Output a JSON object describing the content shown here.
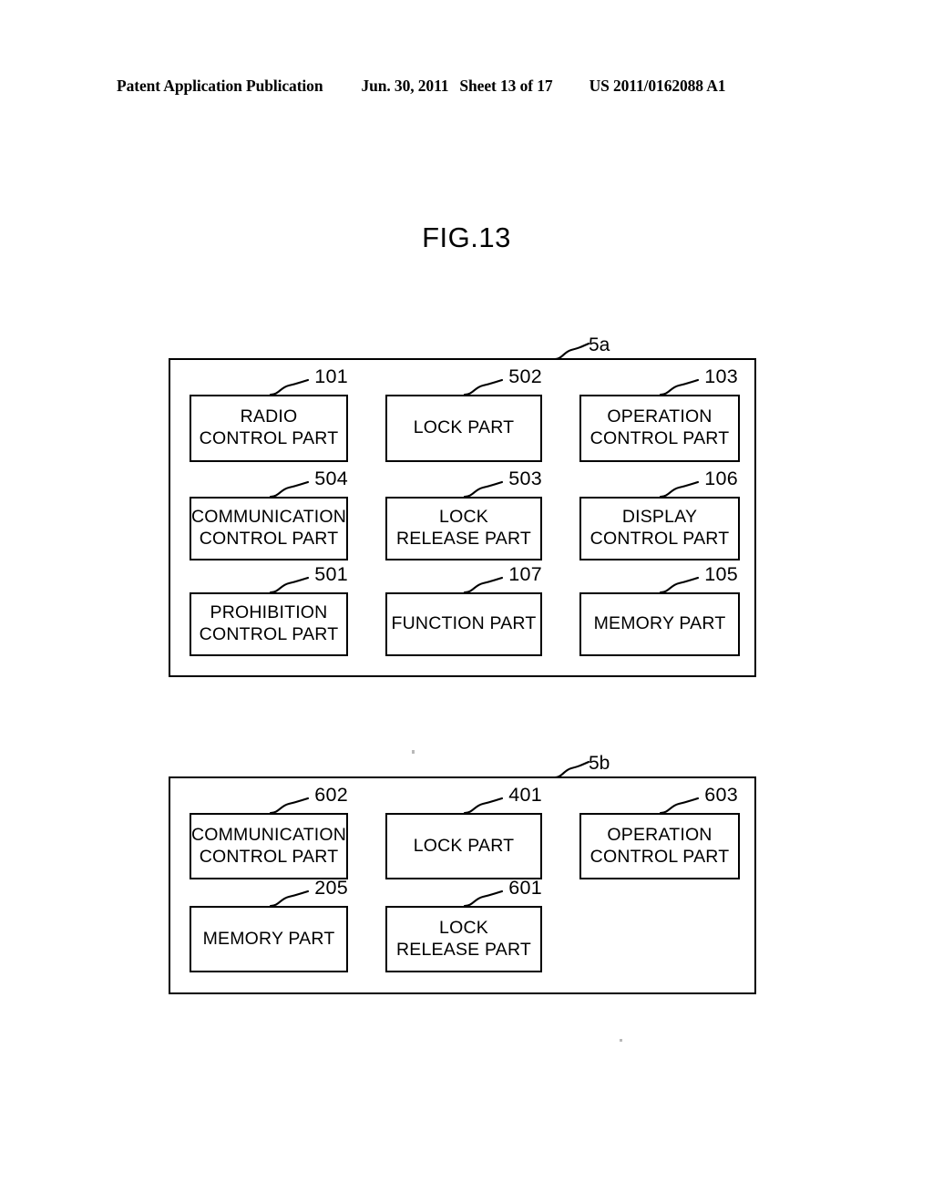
{
  "header": {
    "publication": "Patent Application Publication",
    "date": "Jun. 30, 2011",
    "sheet": "Sheet 13 of 17",
    "document_number": "US 2011/0162088 A1"
  },
  "figure": {
    "title": "FIG.13"
  },
  "diagrams": [
    {
      "id": "5a",
      "tag": "5a",
      "boxes": [
        {
          "ref": "101",
          "label": "RADIO\nCONTROL PART",
          "row": 1,
          "col": 1
        },
        {
          "ref": "502",
          "label": "LOCK PART",
          "row": 1,
          "col": 2
        },
        {
          "ref": "103",
          "label": "OPERATION\nCONTROL PART",
          "row": 1,
          "col": 3
        },
        {
          "ref": "504",
          "label": "COMMUNICATION\nCONTROL PART",
          "row": 2,
          "col": 1
        },
        {
          "ref": "503",
          "label": "LOCK\nRELEASE PART",
          "row": 2,
          "col": 2
        },
        {
          "ref": "106",
          "label": "DISPLAY\nCONTROL PART",
          "row": 2,
          "col": 3
        },
        {
          "ref": "501",
          "label": "PROHIBITION\nCONTROL PART",
          "row": 3,
          "col": 1
        },
        {
          "ref": "107",
          "label": "FUNCTION PART",
          "row": 3,
          "col": 2
        },
        {
          "ref": "105",
          "label": "MEMORY PART",
          "row": 3,
          "col": 3
        }
      ]
    },
    {
      "id": "5b",
      "tag": "5b",
      "boxes": [
        {
          "ref": "602",
          "label": "COMMUNICATION\nCONTROL PART",
          "row": 1,
          "col": 1
        },
        {
          "ref": "401",
          "label": "LOCK PART",
          "row": 1,
          "col": 2
        },
        {
          "ref": "603",
          "label": "OPERATION\nCONTROL PART",
          "row": 1,
          "col": 3
        },
        {
          "ref": "205",
          "label": "MEMORY PART",
          "row": 2,
          "col": 1
        },
        {
          "ref": "601",
          "label": "LOCK\nRELEASE PART",
          "row": 2,
          "col": 2
        }
      ]
    }
  ],
  "colors": {
    "ink": "#000000",
    "paper": "#ffffff"
  }
}
